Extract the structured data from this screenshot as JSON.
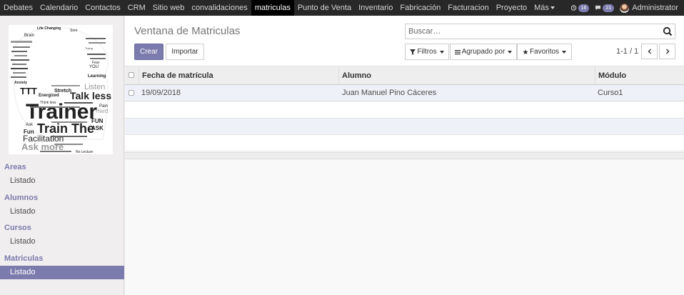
{
  "topbar": {
    "menu": [
      {
        "label": "Debates"
      },
      {
        "label": "Calendario"
      },
      {
        "label": "Contactos"
      },
      {
        "label": "CRM"
      },
      {
        "label": "Sitio web"
      },
      {
        "label": "convalidaciones"
      },
      {
        "label": "matriculas",
        "active": true
      },
      {
        "label": "Punto de Venta"
      },
      {
        "label": "Inventario"
      },
      {
        "label": "Fabricación"
      },
      {
        "label": "Facturacion"
      },
      {
        "label": "Proyecto"
      },
      {
        "label": "Más"
      }
    ],
    "activity_count": "16",
    "chat_count": "21",
    "user_name": "Administrator"
  },
  "sidebar": {
    "logo_words": [
      "Life Changing",
      "Sore",
      "Brain",
      "Listen",
      "Fear",
      "YOU",
      "Learning",
      "Anxiety",
      "Stretch",
      "Energized",
      "Talk less",
      "Trainer",
      "Train The",
      "FUN",
      "ASK",
      "Fun",
      "Facilitation",
      "Ask more",
      "No Lecture",
      "Think less",
      "Pain",
      "Hard",
      "TTT"
    ],
    "sections": [
      {
        "title": "Areas",
        "items": [
          "Listado"
        ]
      },
      {
        "title": "Alumnos",
        "items": [
          "Listado"
        ]
      },
      {
        "title": "Cursos",
        "items": [
          "Listado"
        ]
      },
      {
        "title": "Matriculas",
        "items": [
          "Listado"
        ]
      }
    ]
  },
  "control": {
    "title": "Ventana de Matriculas",
    "search_placeholder": "Buscar…",
    "create_label": "Crear",
    "import_label": "Importar",
    "filters_label": "Filtros",
    "groupby_label": "Agrupado por",
    "favorites_label": "Favoritos",
    "pager": "1-1 / 1"
  },
  "table": {
    "columns": [
      "Fecha de matrícula",
      "Alumno",
      "Módulo"
    ],
    "rows": [
      {
        "fecha": "19/09/2018",
        "alumno": "Juan Manuel Pino Cáceres",
        "modulo": "Curso1"
      }
    ]
  },
  "colors": {
    "brand": "#7c7bad",
    "navbar": "#282829"
  }
}
